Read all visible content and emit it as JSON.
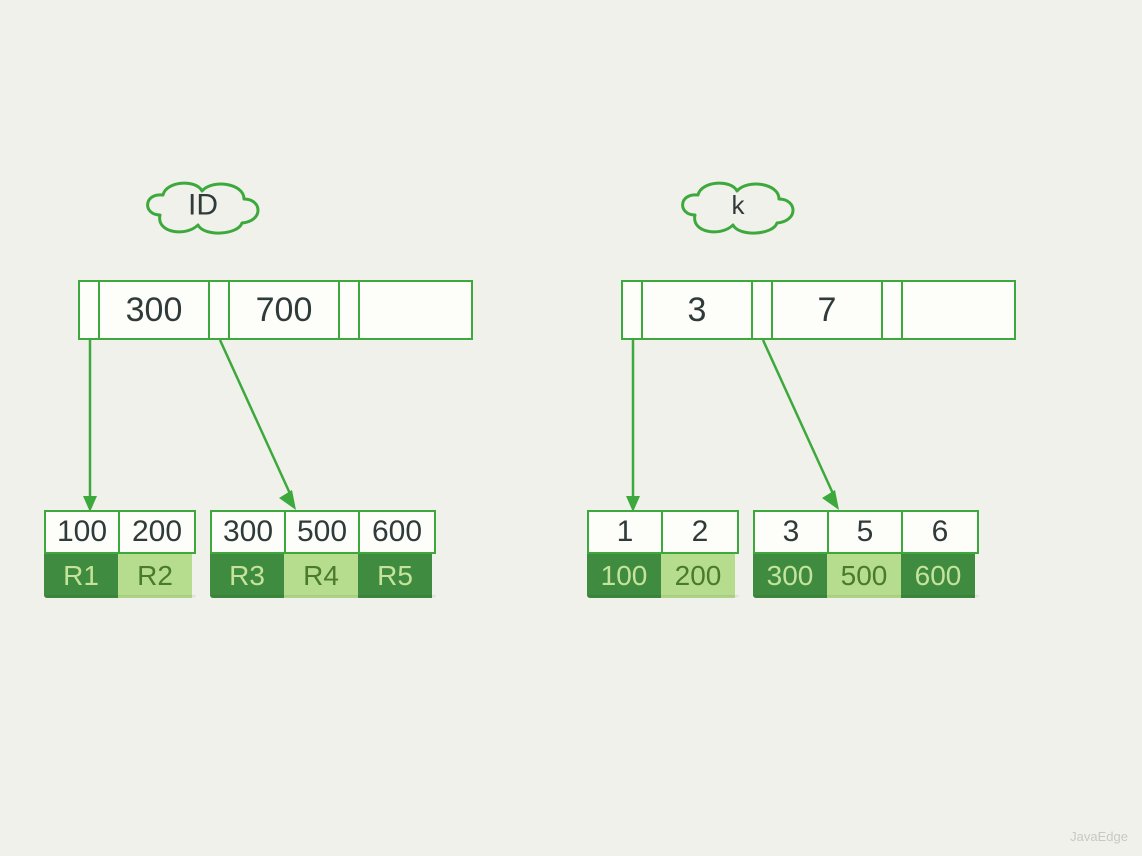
{
  "left_tree": {
    "label": "ID",
    "root_keys": [
      "300",
      "700"
    ],
    "leaves": [
      {
        "keys": [
          "100",
          "200"
        ],
        "data": [
          "R1",
          "R2"
        ]
      },
      {
        "keys": [
          "300",
          "500",
          "600"
        ],
        "data": [
          "R3",
          "R4",
          "R5"
        ]
      }
    ]
  },
  "right_tree": {
    "label": "k",
    "root_keys": [
      "3",
      "7"
    ],
    "leaves": [
      {
        "keys": [
          "1",
          "2"
        ],
        "data": [
          "100",
          "200"
        ]
      },
      {
        "keys": [
          "3",
          "5",
          "6"
        ],
        "data": [
          "300",
          "500",
          "600"
        ]
      }
    ]
  },
  "colors": {
    "stroke": "#3da93d",
    "dark_fill": "#3f8b3f",
    "light_fill": "#b6dd8d",
    "bg": "#f1f1ec"
  },
  "watermark": "JavaEdge"
}
